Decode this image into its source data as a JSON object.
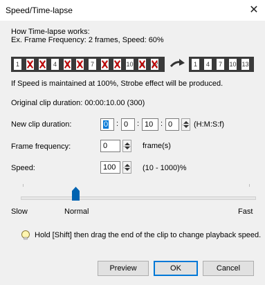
{
  "window": {
    "title": "Speed/Time-lapse",
    "close_glyph": "✕"
  },
  "info": {
    "line1": "How Time-lapse works:",
    "line2": "Ex. Frame Frequency: 2 frames, Speed: 60%",
    "strobe_note": "If Speed is maintained at 100%, Strobe effect will be produced.",
    "original_duration": "Original clip duration: 00:00:10.00 (300)"
  },
  "illustration": {
    "source_frames": [
      "1",
      "2",
      "3",
      "4",
      "5",
      "6",
      "7",
      "8",
      "9",
      "10",
      "11",
      "12"
    ],
    "crossed": [
      "2",
      "3",
      "5",
      "6",
      "8",
      "9",
      "11",
      "12"
    ],
    "result_frames": [
      "1",
      "4",
      "7",
      "10",
      "13"
    ]
  },
  "fields": {
    "new_clip_duration": {
      "label": "New clip duration:",
      "h": "0",
      "m": "0",
      "s": "10",
      "f": "0",
      "sep": ":",
      "unit": "(H:M:S:f)"
    },
    "frame_frequency": {
      "label": "Frame frequency:",
      "value": "0",
      "unit": "frame(s)"
    },
    "speed": {
      "label": "Speed:",
      "value": "100",
      "unit": "(10 - 1000)%"
    }
  },
  "slider": {
    "min_label": "Slow",
    "mid_label": "Normal",
    "max_label": "Fast",
    "value_fraction": 0.22
  },
  "hint": "Hold [Shift] then drag the end of the clip to change playback speed.",
  "buttons": {
    "preview": "Preview",
    "ok": "OK",
    "cancel": "Cancel"
  },
  "colors": {
    "selection": "#0078d7",
    "cross": "#c00000",
    "thumb": "#0063b1"
  }
}
